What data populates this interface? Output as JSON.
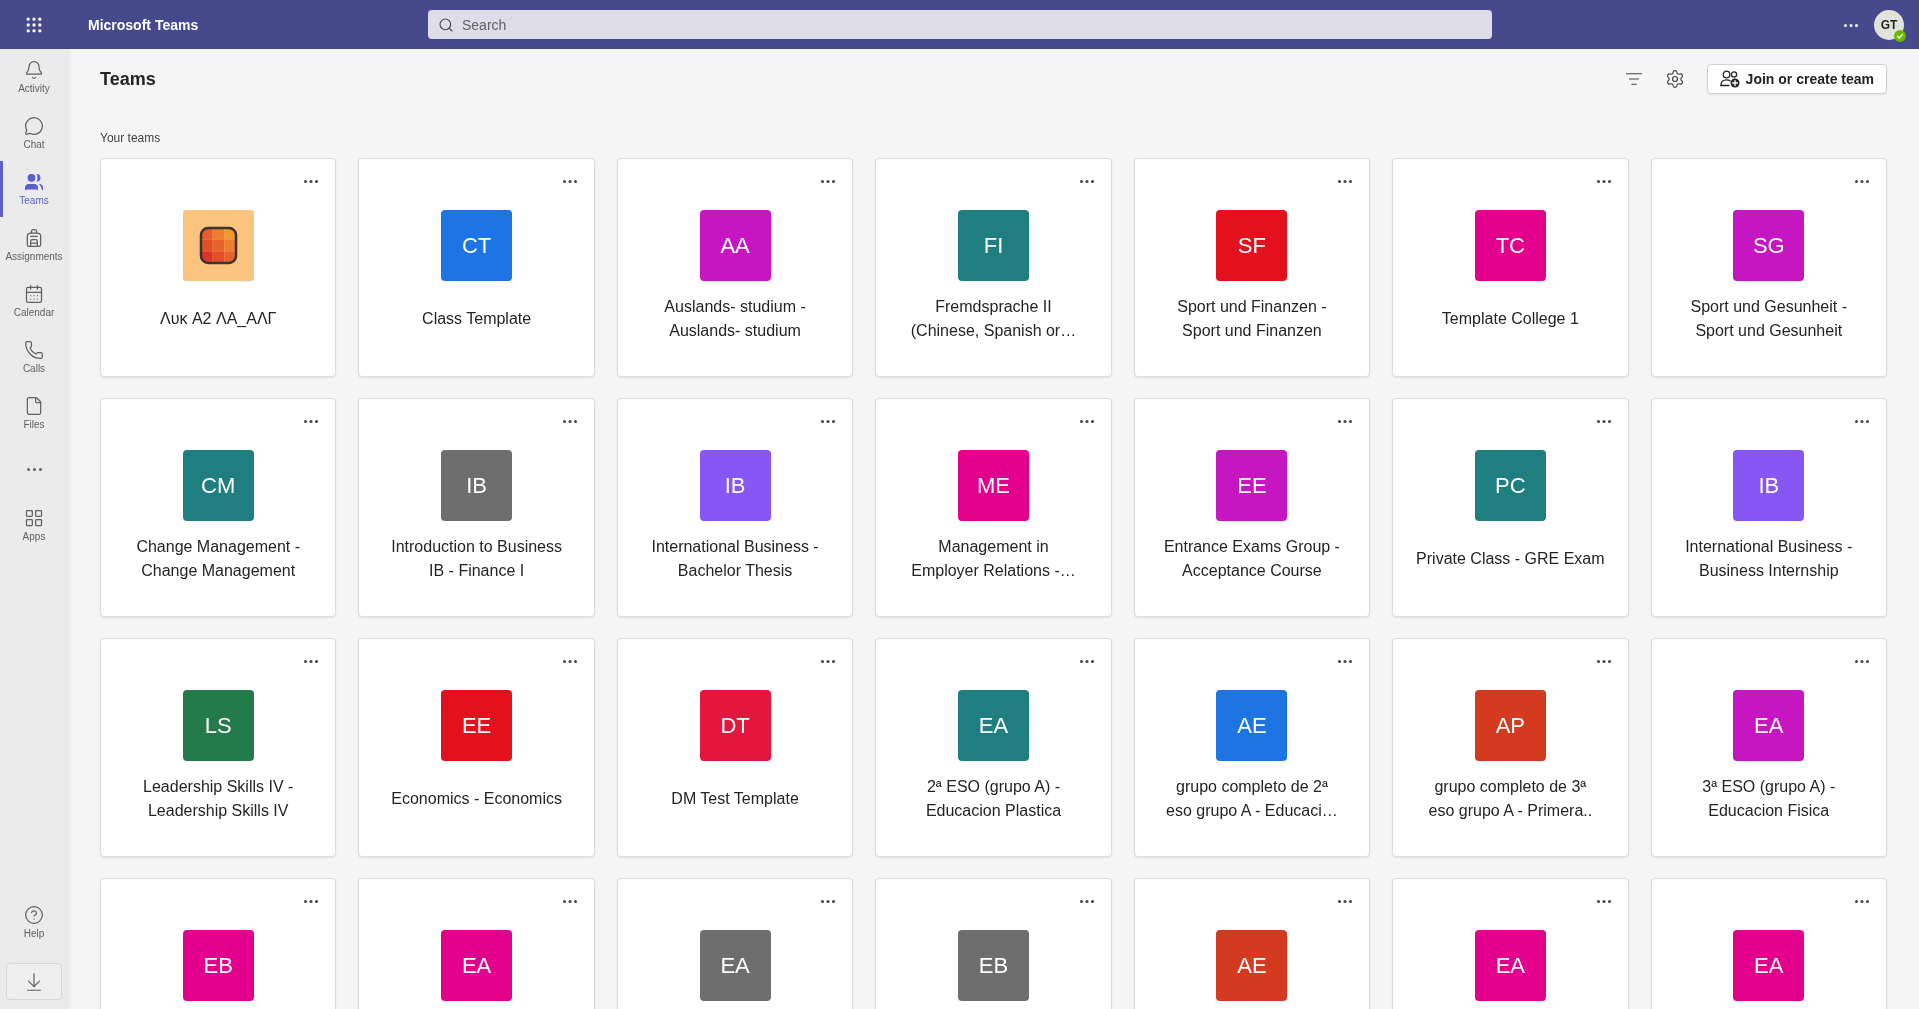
{
  "app_bar": {
    "title": "Microsoft Teams",
    "search": {
      "placeholder": "Search"
    },
    "user": {
      "initials": "GT",
      "available": true
    }
  },
  "sidebar": {
    "items": [
      {
        "kind": "nav",
        "label": "Activity",
        "selected": false
      },
      {
        "kind": "nav",
        "label": "Chat",
        "selected": false
      },
      {
        "kind": "nav",
        "label": "Teams",
        "selected": true
      },
      {
        "kind": "nav",
        "label": "Assignments",
        "selected": false
      },
      {
        "kind": "nav",
        "label": "Calendar",
        "selected": false
      },
      {
        "kind": "nav",
        "label": "Calls",
        "selected": false
      },
      {
        "kind": "nav",
        "label": "Files",
        "selected": false
      },
      {
        "kind": "overflow",
        "selected": false
      },
      {
        "kind": "nav",
        "label": "Apps",
        "selected": false
      }
    ],
    "bottom_items": [
      {
        "kind": "nav",
        "label": "Help",
        "selected": false
      },
      {
        "kind": "download",
        "selected": false
      }
    ]
  },
  "header": {
    "title": "Teams",
    "join_button": "Join or create team"
  },
  "section": {
    "label": "Your teams"
  },
  "teams": [
    {
      "kind": "image",
      "name": "Λυκ A2 ΛΑ_ΑΛΓ"
    },
    {
      "kind": "initials",
      "initials": "CT",
      "color": "#1d74e3",
      "name": "Class Template"
    },
    {
      "kind": "initials",
      "initials": "AA",
      "color": "#c616c2",
      "name": "Auslands- studium -\nAuslands- studium"
    },
    {
      "kind": "initials",
      "initials": "FI",
      "color": "#1f7f80",
      "name": "Fremdsprache II\n(Chinese, Spanish or…"
    },
    {
      "kind": "initials",
      "initials": "SF",
      "color": "#e3101d",
      "name": "Sport und Finanzen -\nSport und Finanzen"
    },
    {
      "kind": "initials",
      "initials": "TC",
      "color": "#e3008c",
      "name": "Template College 1"
    },
    {
      "kind": "initials",
      "initials": "SG",
      "color": "#c616c2",
      "name": "Sport und Gesunheit -\nSport und Gesunheit"
    },
    {
      "kind": "initials",
      "initials": "CM",
      "color": "#1f7f80",
      "name": "Change Management -\nChange Management"
    },
    {
      "kind": "initials",
      "initials": "IB",
      "color": "#6e6e6e",
      "name": "Introduction to Business\nIB - Finance I"
    },
    {
      "kind": "initials",
      "initials": "IB",
      "color": "#8856f4",
      "name": "International Business -\nBachelor Thesis"
    },
    {
      "kind": "initials",
      "initials": "ME",
      "color": "#e3008c",
      "name": "Management in\nEmployer Relations -…"
    },
    {
      "kind": "initials",
      "initials": "EE",
      "color": "#c616c2",
      "name": "Entrance Exams Group -\nAcceptance Course"
    },
    {
      "kind": "initials",
      "initials": "PC",
      "color": "#1f7f80",
      "name": "Private Class - GRE Exam"
    },
    {
      "kind": "initials",
      "initials": "IB",
      "color": "#8856f4",
      "name": "International Business -\nBusiness Internship"
    },
    {
      "kind": "initials",
      "initials": "LS",
      "color": "#237b4b",
      "name": "Leadership Skills IV -\nLeadership Skills IV"
    },
    {
      "kind": "initials",
      "initials": "EE",
      "color": "#e3101d",
      "name": "Economics - Economics"
    },
    {
      "kind": "initials",
      "initials": "DT",
      "color": "#e3173e",
      "name": "DM Test Template"
    },
    {
      "kind": "initials",
      "initials": "EA",
      "color": "#1f7f80",
      "name": "2ª ESO (grupo A) -\nEducacion Plastica"
    },
    {
      "kind": "initials",
      "initials": "AE",
      "color": "#1d74e3",
      "name": "grupo completo de 2ª\neso grupo A - Educaci…"
    },
    {
      "kind": "initials",
      "initials": "AP",
      "color": "#d43a1f",
      "name": "grupo completo de 3ª\neso grupo A - Primera.."
    },
    {
      "kind": "initials",
      "initials": "EA",
      "color": "#c616c2",
      "name": "3ª ESO (grupo A) -\nEducacion Fisica"
    },
    {
      "kind": "initials",
      "initials": "EB",
      "color": "#e3008c"
    },
    {
      "kind": "initials",
      "initials": "EA",
      "color": "#e3008c"
    },
    {
      "kind": "initials",
      "initials": "EA",
      "color": "#6e6e6e"
    },
    {
      "kind": "initials",
      "initials": "EB",
      "color": "#6e6e6e"
    },
    {
      "kind": "initials",
      "initials": "AE",
      "color": "#d43a1f"
    },
    {
      "kind": "initials",
      "initials": "EA",
      "color": "#e3008c"
    },
    {
      "kind": "initials",
      "initials": "EA",
      "color": "#e3008c"
    }
  ]
}
